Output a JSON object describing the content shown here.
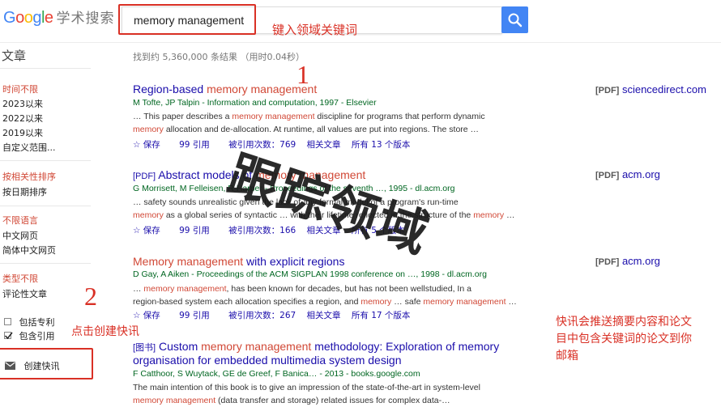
{
  "header": {
    "logo_google": [
      "G",
      "o",
      "o",
      "g",
      "l",
      "e"
    ],
    "logo_suffix": "学术搜索",
    "search_value": "memory management"
  },
  "annotations": {
    "step1_number": "1",
    "step1_text": "键入领域关键词",
    "step2_number": "2",
    "step2_text": "点击创建快讯",
    "watermark": "跟踪领域",
    "note_line1": "快讯会推送摘要内容和论文",
    "note_line2": "目中包含关键词的论文到你",
    "note_line3": "邮箱"
  },
  "sidebar": {
    "title": "文章",
    "time_filters": [
      "时间不限",
      "2023以来",
      "2022以来",
      "2019以来",
      "自定义范围..."
    ],
    "sort": [
      "按相关性排序",
      "按日期排序"
    ],
    "language": [
      "不限语言",
      "中文网页",
      "简体中文网页"
    ],
    "type": [
      "类型不限",
      "评论性文章"
    ],
    "include_patents": "包括专利",
    "include_citations": "包含引用",
    "create_alert": "创建快讯"
  },
  "results": {
    "stats": "找到约 5,360,000 条结果 （用时0.04秒）",
    "items": [
      {
        "tag": "",
        "title_pre": "Region-based ",
        "title_hl": "memory management",
        "title_post": "",
        "authors": "M Tofte, JP Talpin - Information and computation, 1997 - Elsevier",
        "snippet_line1": "… This paper describes a memory management discipline for programs that perform dynamic",
        "snippet_line2": "memory allocation and de-allocation. At runtime, all values are put into regions. The store …",
        "save": "保存",
        "cite": "引用",
        "cited_by": "被引用次数：769",
        "related": "相关文章",
        "versions": "所有 13 个版本",
        "pdf_type": "[PDF]",
        "pdf_source": "sciencedirect.com"
      },
      {
        "tag": "[PDF]",
        "title_pre": "Abstract models of ",
        "title_hl": "memory management",
        "title_post": "",
        "authors": "G Morrisett, M Felleisen, R Harper - Proceedings of the seventh …, 1995 - dl.acm.org",
        "snippet_line1": "… safety sounds unrealistic given the lack of any formal model of a program's run-time",
        "snippet_line2": "memory as a global series of syntactic … with their lifetime reflected in the structure of the memory …",
        "save": "保存",
        "cite": "引用",
        "cited_by": "被引用次数：166",
        "related": "相关文章",
        "versions": "所有 5 个版本",
        "pdf_type": "[PDF]",
        "pdf_source": "acm.org"
      },
      {
        "tag": "",
        "title_pre": "",
        "title_hl": "Memory management",
        "title_post": " with explicit regions",
        "authors": "D Gay, A Aiken - Proceedings of the ACM SIGPLAN 1998 conference on …, 1998 - dl.acm.org",
        "snippet_line1": "… memory management, has been known for decades, but has not been wellstudied, In a",
        "snippet_line2": "region-based system each allocation specifies a region, and memory … safe memory management …",
        "save": "保存",
        "cite": "引用",
        "cited_by": "被引用次数：267",
        "related": "相关文章",
        "versions": "所有 17 个版本",
        "pdf_type": "[PDF]",
        "pdf_source": "acm.org"
      },
      {
        "tag": "[图书]",
        "title_pre": "Custom ",
        "title_hl": "memory management",
        "title_post": " methodology: Exploration of memory",
        "title_line2": "organisation for embedded multimedia system design",
        "authors": "F Catthoor, S Wuytack, GE de Greef, F Banica… - 2013 - books.google.com",
        "snippet_line1": "The main intention of this book is to give an impression of the state-of-the-art in system-level",
        "snippet_line2": "memory management (data transfer and storage) related issues for complex data-…"
      }
    ]
  }
}
